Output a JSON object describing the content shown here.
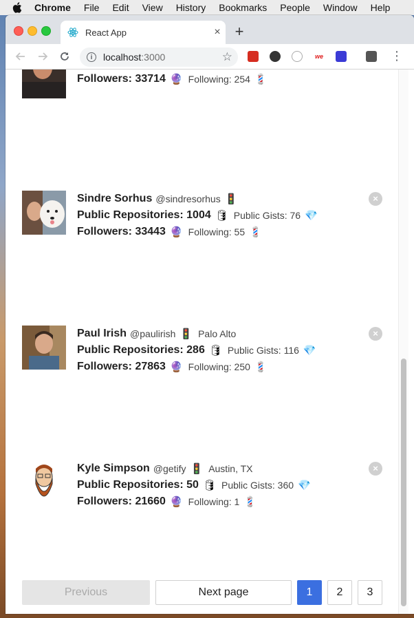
{
  "menubar": {
    "app": "Chrome",
    "items": [
      "File",
      "Edit",
      "View",
      "History",
      "Bookmarks",
      "People",
      "Window",
      "Help"
    ]
  },
  "browser": {
    "tab_title": "React App",
    "url_host": "localhost",
    "url_port": ":3000"
  },
  "users": [
    {
      "name": "",
      "login": "",
      "location": "",
      "followers": "Followers: 33714",
      "following": "Following: 254"
    },
    {
      "name": "Sindre Sorhus",
      "login": "@sindresorhus",
      "location": "",
      "repos": "Public Repositories: 1004",
      "gists": "Public Gists: 76",
      "followers": "Followers: 33443",
      "following": "Following: 55"
    },
    {
      "name": "Paul Irish",
      "login": "@paulirish",
      "location": "Palo Alto",
      "repos": "Public Repositories: 286",
      "gists": "Public Gists: 116",
      "followers": "Followers: 27863",
      "following": "Following: 250"
    },
    {
      "name": "Kyle Simpson",
      "login": "@getify",
      "location": "Austin, TX",
      "repos": "Public Repositories: 50",
      "gists": "Public Gists: 360",
      "followers": "Followers: 21660",
      "following": "Following: 1"
    }
  ],
  "emoji": {
    "traffic": "🚦",
    "barrel": "🛢",
    "gem": "💎",
    "crystal": "🔮",
    "pole": "💈"
  },
  "pagination": {
    "previous": "Previous",
    "next": "Next page",
    "pages": [
      "1",
      "2",
      "3"
    ],
    "current": 1
  },
  "icons": {
    "close": "×"
  }
}
